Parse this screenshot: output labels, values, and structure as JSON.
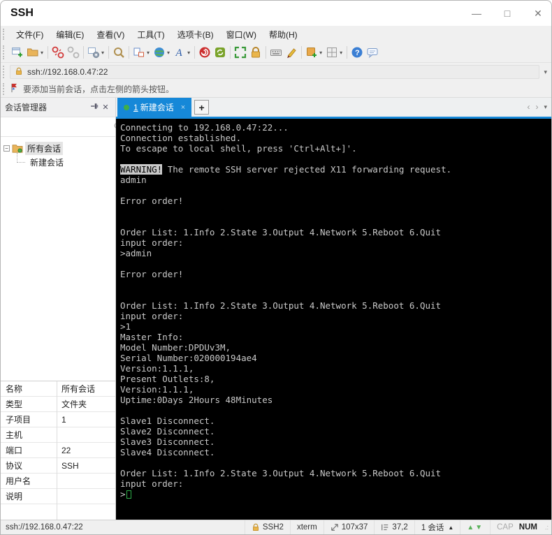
{
  "window": {
    "title": "SSH",
    "minimize": "—",
    "maximize": "□",
    "close": "✕"
  },
  "menu": {
    "items": [
      "文件(F)",
      "编辑(E)",
      "查看(V)",
      "工具(T)",
      "选项卡(B)",
      "窗口(W)",
      "帮助(H)"
    ]
  },
  "toolbar": {
    "groups": [
      [
        {
          "name": "new-session-icon"
        },
        {
          "name": "open-session-icon",
          "dropdown": true
        }
      ],
      [
        {
          "name": "disconnect-icon"
        },
        {
          "name": "reconnect-icon"
        }
      ],
      [
        {
          "name": "session-properties-icon",
          "dropdown": true
        }
      ],
      [
        {
          "name": "find-icon"
        }
      ],
      [
        {
          "name": "layout-icon",
          "dropdown": true
        },
        {
          "name": "web-icon",
          "dropdown": true
        },
        {
          "name": "font-icon",
          "dropdown": true
        }
      ],
      [
        {
          "name": "log-icon"
        },
        {
          "name": "refresh-icon"
        }
      ],
      [
        {
          "name": "fullscreen-icon"
        },
        {
          "name": "lock-icon"
        }
      ],
      [
        {
          "name": "virtual-keyboard-icon"
        },
        {
          "name": "highlight-pen-icon"
        }
      ],
      [
        {
          "name": "new-file-icon",
          "dropdown": true
        },
        {
          "name": "grid-view-icon",
          "dropdown": true
        }
      ],
      [
        {
          "name": "help-icon"
        },
        {
          "name": "feedback-icon"
        }
      ]
    ]
  },
  "address_bar": {
    "value": "ssh://192.168.0.47:22",
    "dropdown": "▾"
  },
  "info_bar": {
    "text": "要添加当前会话，点击左侧的箭头按钮。"
  },
  "session_manager": {
    "title": "会话管理器",
    "pin": "⊥",
    "close": "✕",
    "root_label": "所有会话",
    "child_label": "新建会话"
  },
  "properties": {
    "rows": [
      [
        "名称",
        "所有会话"
      ],
      [
        "类型",
        "文件夹"
      ],
      [
        "子项目",
        "1"
      ],
      [
        "主机",
        ""
      ],
      [
        "端口",
        "22"
      ],
      [
        "协议",
        "SSH"
      ],
      [
        "用户名",
        ""
      ],
      [
        "说明",
        ""
      ]
    ]
  },
  "tabs": {
    "active_number": "1",
    "active_label": "新建会话",
    "close": "×",
    "add": "+",
    "nav_prev": "‹",
    "nav_next": "›",
    "nav_drop": "▾"
  },
  "terminal": {
    "warning_token": "WARNING!",
    "lines": [
      "Connecting to 192.168.0.47:22...",
      "Connection established.",
      "To escape to local shell, press 'Ctrl+Alt+]'.",
      "",
      "WARNING! The remote SSH server rejected X11 forwarding request.",
      "admin",
      "",
      "Error order!",
      "",
      "",
      "Order List: 1.Info 2.State 3.Output 4.Network 5.Reboot 6.Quit",
      "input order:",
      ">admin",
      "",
      "Error order!",
      "",
      "",
      "Order List: 1.Info 2.State 3.Output 4.Network 5.Reboot 6.Quit",
      "input order:",
      ">1",
      "Master Info:",
      "Model Number:DPDUv3M,",
      "Serial Number:020000194ae4",
      "Version:1.1.1,",
      "Present Outlets:8,",
      "Version:1.1.1,",
      "Uptime:0Days 2Hours 48Minutes",
      "",
      "Slave1 Disconnect.",
      "Slave2 Disconnect.",
      "Slave3 Disconnect.",
      "Slave4 Disconnect.",
      "",
      "Order List: 1.Info 2.State 3.Output 4.Network 5.Reboot 6.Quit",
      "input order:",
      ">"
    ],
    "cursor_after_last": true
  },
  "status_bar": {
    "left": "ssh://192.168.0.47:22",
    "protocol": "SSH2",
    "term_type": "xterm",
    "size": "107x37",
    "position": "37,2",
    "sessions": "1 会话",
    "sessions_drop": "▲",
    "arrows": "▲▼",
    "cap": "CAP",
    "num": "NUM"
  },
  "colors": {
    "accent": "#1688d8",
    "terminal_bg": "#000000",
    "terminal_fg": "#c9c9c9",
    "cursor_green": "#2fae4a",
    "tab_dot_green": "#3fae49",
    "lock_yellow": "#e8b53a"
  }
}
